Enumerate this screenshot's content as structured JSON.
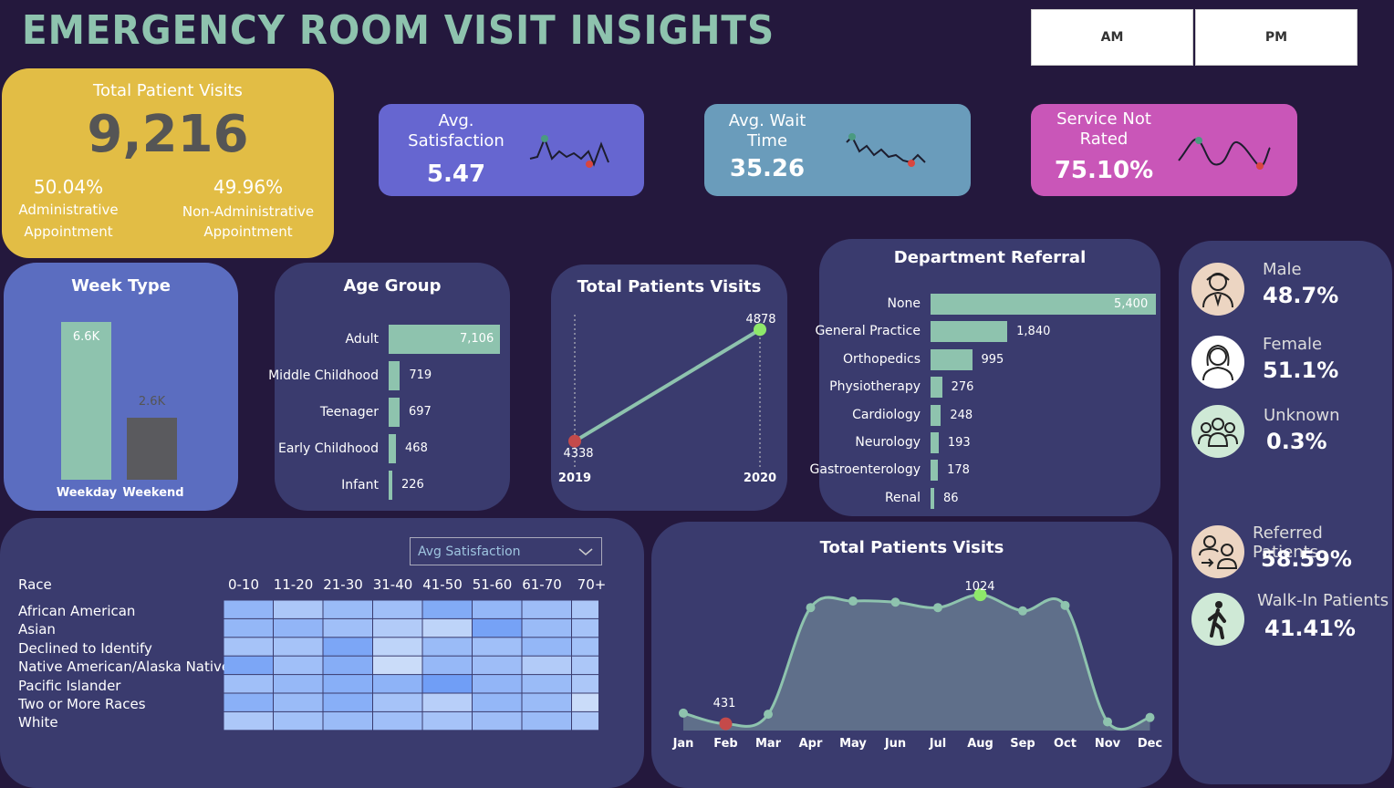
{
  "header": {
    "title": "EMERGENCY ROOM VISIT INSIGHTS",
    "am_label": "AM",
    "pm_label": "PM"
  },
  "total_card": {
    "label": "Total Patient Visits",
    "value": "9,216",
    "admin_pct": "50.04%",
    "admin_label_1": "Administrative",
    "admin_label_2": "Appointment",
    "nonadmin_pct": "49.96%",
    "nonadmin_label_1": "Non-Administrative",
    "nonadmin_label_2": "Appointment"
  },
  "kpis": {
    "satisfaction": {
      "label_1": "Avg.",
      "label_2": "Satisfaction",
      "value": "5.47"
    },
    "wait": {
      "label_1": "Avg. Wait",
      "label_2": "Time",
      "value": "35.26"
    },
    "not_rated": {
      "label_1": "Service Not",
      "label_2": "Rated",
      "value": "75.10%"
    }
  },
  "colors": {
    "background": "#24183d",
    "accent": "#8ec3ae",
    "yellow": "#e2bd45",
    "purple_kpi": "#6666d0",
    "blue_kpi": "#6a9cbb",
    "magenta_kpi": "#c956b8",
    "card": "#3a3b6e",
    "week_card": "#5b6dc0"
  },
  "week_type": {
    "title": "Week Type",
    "categories": [
      "Weekday",
      "Weekend"
    ],
    "values": [
      6.6,
      2.6
    ],
    "labels": [
      "6.6K",
      "2.6K"
    ]
  },
  "age_group": {
    "title": "Age Group",
    "categories": [
      "Adult",
      "Middle Childhood",
      "Teenager",
      "Early Childhood",
      "Infant"
    ],
    "values": [
      7106,
      719,
      697,
      468,
      226
    ],
    "labels": [
      "7,106",
      "719",
      "697",
      "468",
      "226"
    ]
  },
  "yearly": {
    "title": "Total Patients Visits",
    "years": [
      "2019",
      "2020"
    ],
    "values": [
      4338,
      4878
    ],
    "labels": [
      "4338",
      "4878"
    ]
  },
  "department": {
    "title": "Department Referral",
    "categories": [
      "None",
      "General Practice",
      "Orthopedics",
      "Physiotherapy",
      "Cardiology",
      "Neurology",
      "Gastroenterology",
      "Renal"
    ],
    "values": [
      5400,
      1840,
      995,
      276,
      248,
      193,
      178,
      86
    ],
    "labels": [
      "5,400",
      "1,840",
      "995",
      "276",
      "248",
      "193",
      "178",
      "86"
    ]
  },
  "gender": {
    "male": {
      "label": "Male",
      "value": "48.7%"
    },
    "female": {
      "label": "Female",
      "value": "51.1%"
    },
    "unknown": {
      "label": "Unknown",
      "value": "0.3%"
    },
    "referred": {
      "label": "Referred Patients",
      "value": "58.59%"
    },
    "walkin": {
      "label": "Walk-In Patients",
      "value": "41.41%"
    }
  },
  "heatmap": {
    "select_value": "Avg Satisfaction",
    "row_header": "Race",
    "columns": [
      "0-10",
      "11-20",
      "21-30",
      "31-40",
      "41-50",
      "51-60",
      "61-70",
      "70+"
    ],
    "rows": [
      "African American",
      "Asian",
      "Declined to Identify",
      "Native American/Alaska Native",
      "Pacific Islander",
      "Two or More Races",
      "White"
    ]
  },
  "monthly": {
    "title": "Total Patients Visits",
    "months": [
      "Jan",
      "Feb",
      "Mar",
      "Apr",
      "May",
      "Jun",
      "Jul",
      "Aug",
      "Sep",
      "Oct",
      "Nov",
      "Dec"
    ],
    "min_label": "431",
    "max_label": "1024"
  },
  "chart_data": [
    {
      "type": "bar",
      "title": "Week Type",
      "categories": [
        "Weekday",
        "Weekend"
      ],
      "values": [
        6600,
        2600
      ]
    },
    {
      "type": "bar",
      "title": "Age Group",
      "categories": [
        "Adult",
        "Middle Childhood",
        "Teenager",
        "Early Childhood",
        "Infant"
      ],
      "values": [
        7106,
        719,
        697,
        468,
        226
      ]
    },
    {
      "type": "line",
      "title": "Total Patients Visits",
      "x": [
        "2019",
        "2020"
      ],
      "values": [
        4338,
        4878
      ]
    },
    {
      "type": "bar",
      "title": "Department Referral",
      "categories": [
        "None",
        "General Practice",
        "Orthopedics",
        "Physiotherapy",
        "Cardiology",
        "Neurology",
        "Gastroenterology",
        "Renal"
      ],
      "values": [
        5400,
        1840,
        995,
        276,
        248,
        193,
        178,
        86
      ]
    },
    {
      "type": "heatmap",
      "x": [
        "0-10",
        "11-20",
        "21-30",
        "31-40",
        "41-50",
        "51-60",
        "61-70",
        "70+"
      ],
      "y": [
        "African American",
        "Asian",
        "Declined to Identify",
        "Native American/Alaska Native",
        "Pacific Islander",
        "Two or More Races",
        "White"
      ],
      "values": [
        [
          0.62,
          0.4,
          0.55,
          0.5,
          0.75,
          0.6,
          0.52,
          0.4
        ],
        [
          0.6,
          0.62,
          0.5,
          0.35,
          0.25,
          0.85,
          0.55,
          0.45
        ],
        [
          0.45,
          0.45,
          0.8,
          0.25,
          0.55,
          0.5,
          0.6,
          0.48
        ],
        [
          0.8,
          0.5,
          0.72,
          0.15,
          0.58,
          0.52,
          0.35,
          0.4
        ],
        [
          0.5,
          0.58,
          0.7,
          0.65,
          0.9,
          0.62,
          0.55,
          0.4
        ],
        [
          0.68,
          0.55,
          0.7,
          0.45,
          0.3,
          0.6,
          0.55,
          0.15
        ],
        [
          0.4,
          0.48,
          0.55,
          0.5,
          0.45,
          0.52,
          0.55,
          0.4
        ]
      ]
    },
    {
      "type": "area",
      "title": "Total Patients Visits",
      "x": [
        "Jan",
        "Feb",
        "Mar",
        "Apr",
        "May",
        "Jun",
        "Jul",
        "Aug",
        "Sep",
        "Oct",
        "Nov",
        "Dec"
      ],
      "values": [
        480,
        431,
        475,
        965,
        995,
        990,
        965,
        1024,
        950,
        975,
        440,
        460
      ]
    }
  ]
}
